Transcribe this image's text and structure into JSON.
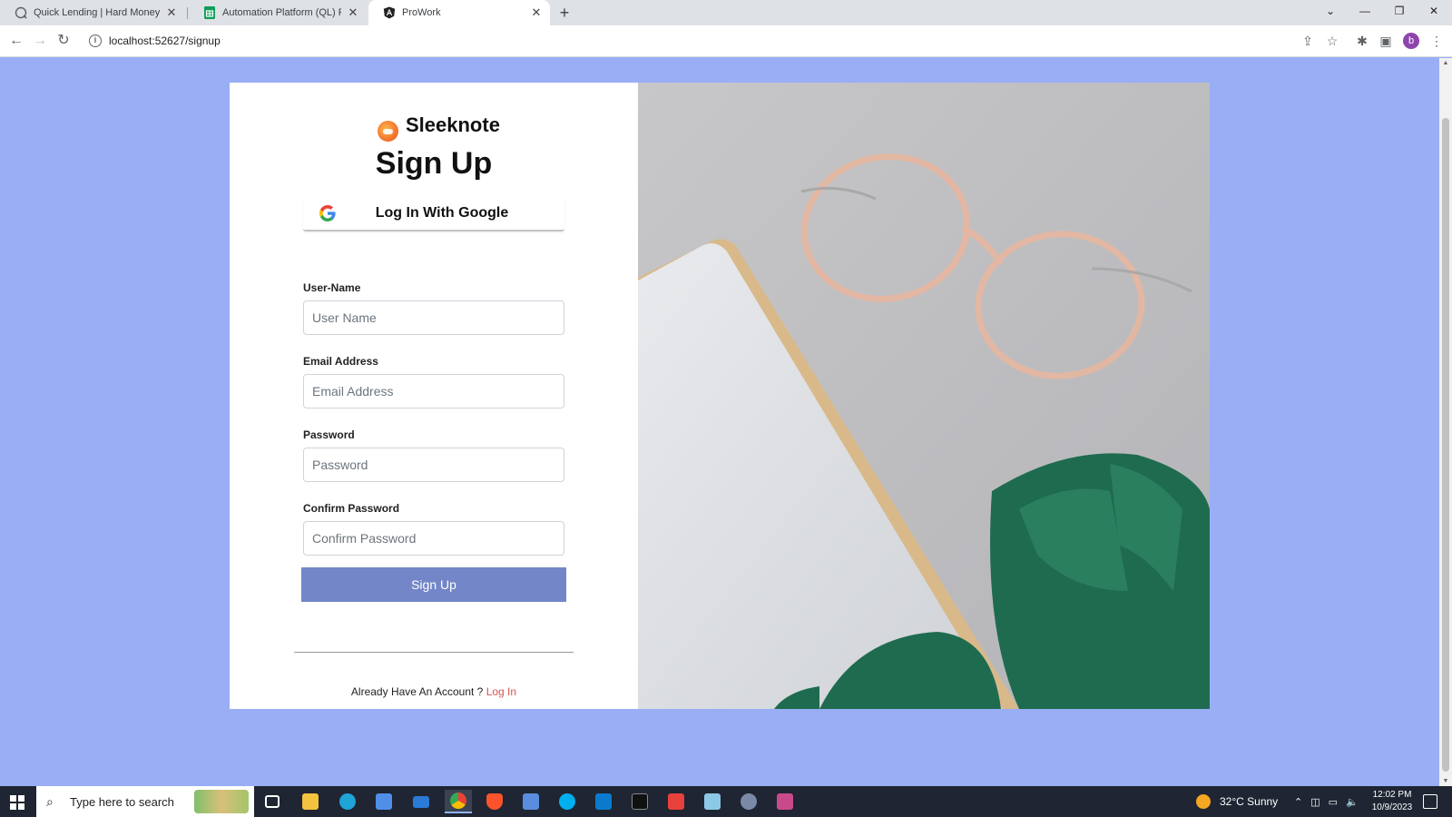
{
  "browser": {
    "tabs": [
      {
        "title": "Quick Lending | Hard Money Le",
        "active": false
      },
      {
        "title": "Automation Platform (QL) Funtic",
        "active": false
      },
      {
        "title": "ProWork",
        "active": true
      }
    ],
    "new_tab": "+",
    "url": "localhost:52627/signup",
    "profile_initial": "b"
  },
  "signup": {
    "brand_name": "Sleeknote",
    "heading": "Sign Up",
    "google_button": "Log In With Google",
    "fields": [
      {
        "label": "User-Name",
        "placeholder": "User Name"
      },
      {
        "label": "Email Address",
        "placeholder": "Email Address"
      },
      {
        "label": "Password",
        "placeholder": "Password"
      },
      {
        "label": "Confirm Password",
        "placeholder": "Confirm Password"
      }
    ],
    "submit_label": "Sign Up",
    "footer_text": "Already Have An Account ? ",
    "footer_link": "Log In"
  },
  "taskbar": {
    "search_placeholder": "Type here to search",
    "weather": "32°C  Sunny",
    "time": "12:02 PM",
    "date": "10/9/2023"
  },
  "colors": {
    "page_background": "#99aef5",
    "submit_button": "#7286c8",
    "login_link": "#d9534f",
    "brand_logo": "#f06a28"
  }
}
